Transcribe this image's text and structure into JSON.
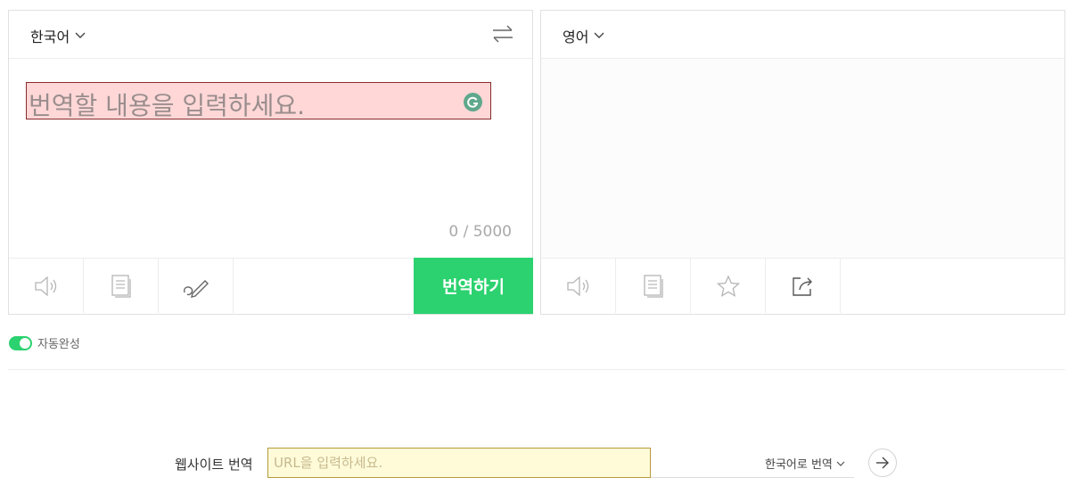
{
  "source": {
    "language": "한국어",
    "placeholder": "번역할 내용을 입력하세요.",
    "counter": "0 / 5000",
    "tools": [
      "speaker-icon",
      "copy-icon",
      "handwriting-icon"
    ],
    "translate_label": "번역하기"
  },
  "target": {
    "language": "영어",
    "tools": [
      "speaker-icon",
      "copy-icon",
      "star-icon",
      "share-icon"
    ]
  },
  "options": {
    "autocomplete_label": "자동완성",
    "autocomplete_on": true
  },
  "website": {
    "label": "웹사이트 번역",
    "placeholder": "URL을 입력하세요.",
    "target_lang": "한국어로 번역"
  },
  "colors": {
    "accent": "#2bd26f",
    "source_highlight": "#ffd7d7",
    "url_highlight": "#fffbd9",
    "grammarly": "#5fa88c"
  }
}
